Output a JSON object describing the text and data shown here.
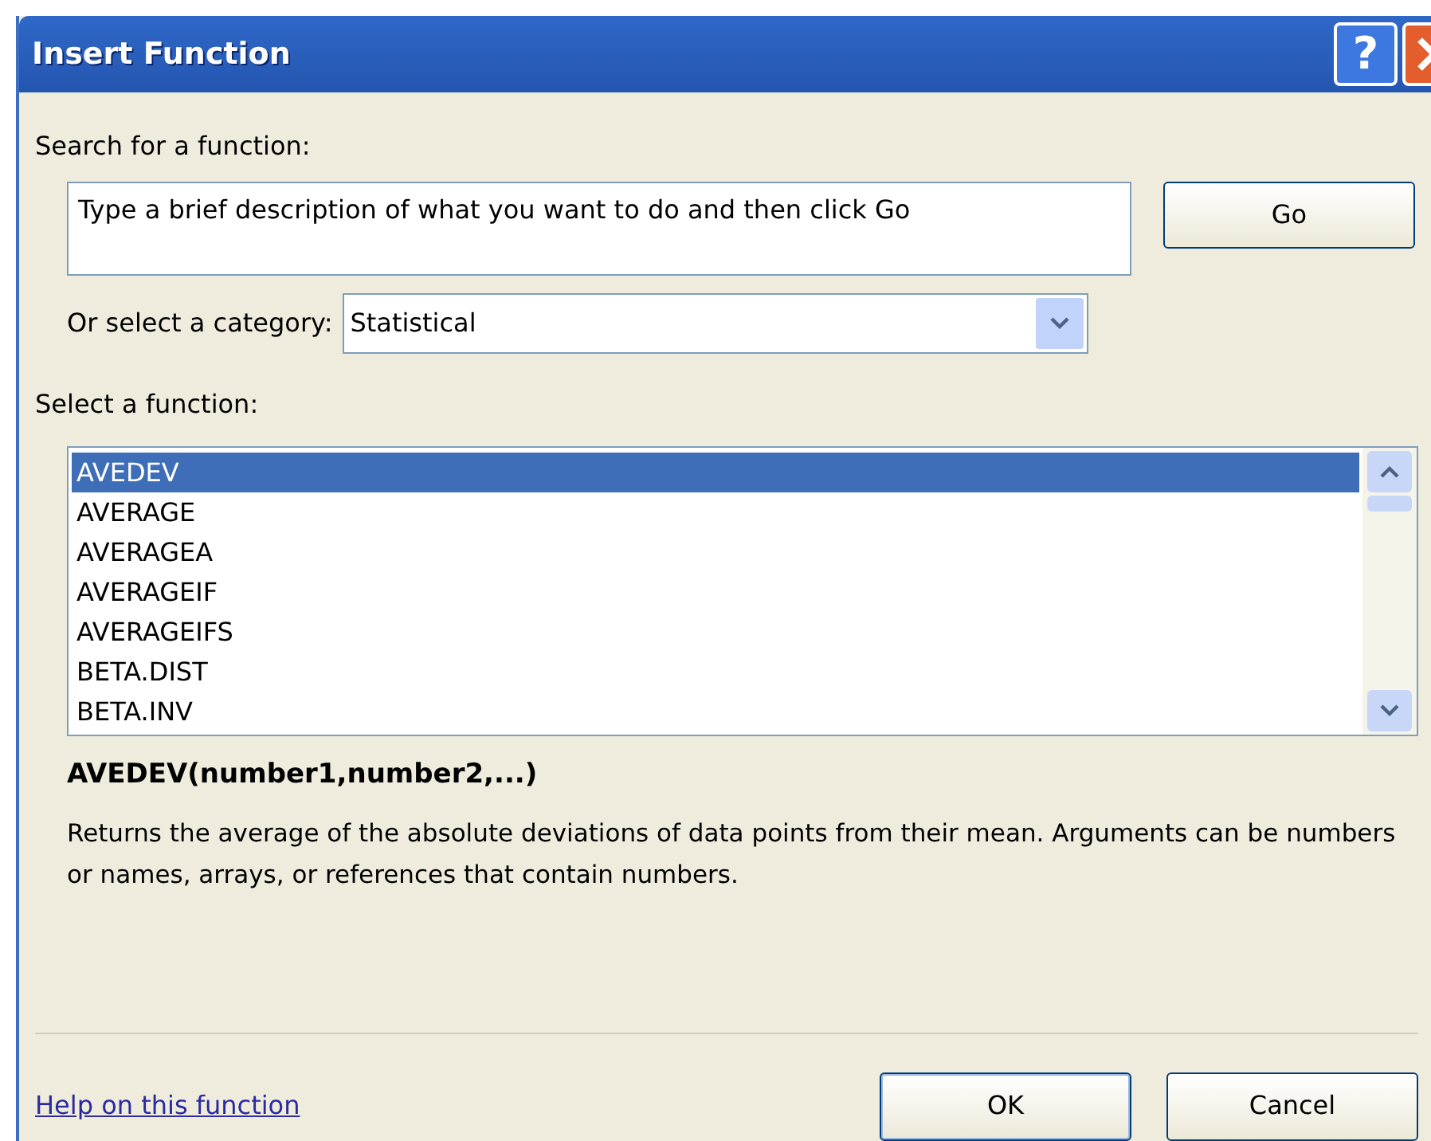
{
  "window": {
    "title": "Insert Function"
  },
  "title_buttons": [
    {
      "kind": "help",
      "label": "?"
    },
    {
      "kind": "close"
    }
  ],
  "search": {
    "label": "Search for a function:",
    "placeholder": "Type a brief description of what you want to do and then click Go",
    "button": "Go"
  },
  "category": {
    "label": "Or select a category:",
    "value": "Statistical"
  },
  "functions": {
    "label": "Select a function:",
    "items": [
      {
        "name": "AVEDEV",
        "selected": true
      },
      {
        "name": "AVERAGE",
        "selected": false
      },
      {
        "name": "AVERAGEA",
        "selected": false
      },
      {
        "name": "AVERAGEIF",
        "selected": false
      },
      {
        "name": "AVERAGEIFS",
        "selected": false
      },
      {
        "name": "BETA.DIST",
        "selected": false
      },
      {
        "name": "BETA.INV",
        "selected": false
      }
    ]
  },
  "signature": "AVEDEV(number1,number2,...)",
  "description": "Returns the average of the absolute deviations of data points from their mean. Arguments can be numbers or names, arrays, or references that contain numbers.",
  "help_link": "Help on this function",
  "buttons": [
    "OK",
    "Cancel"
  ]
}
